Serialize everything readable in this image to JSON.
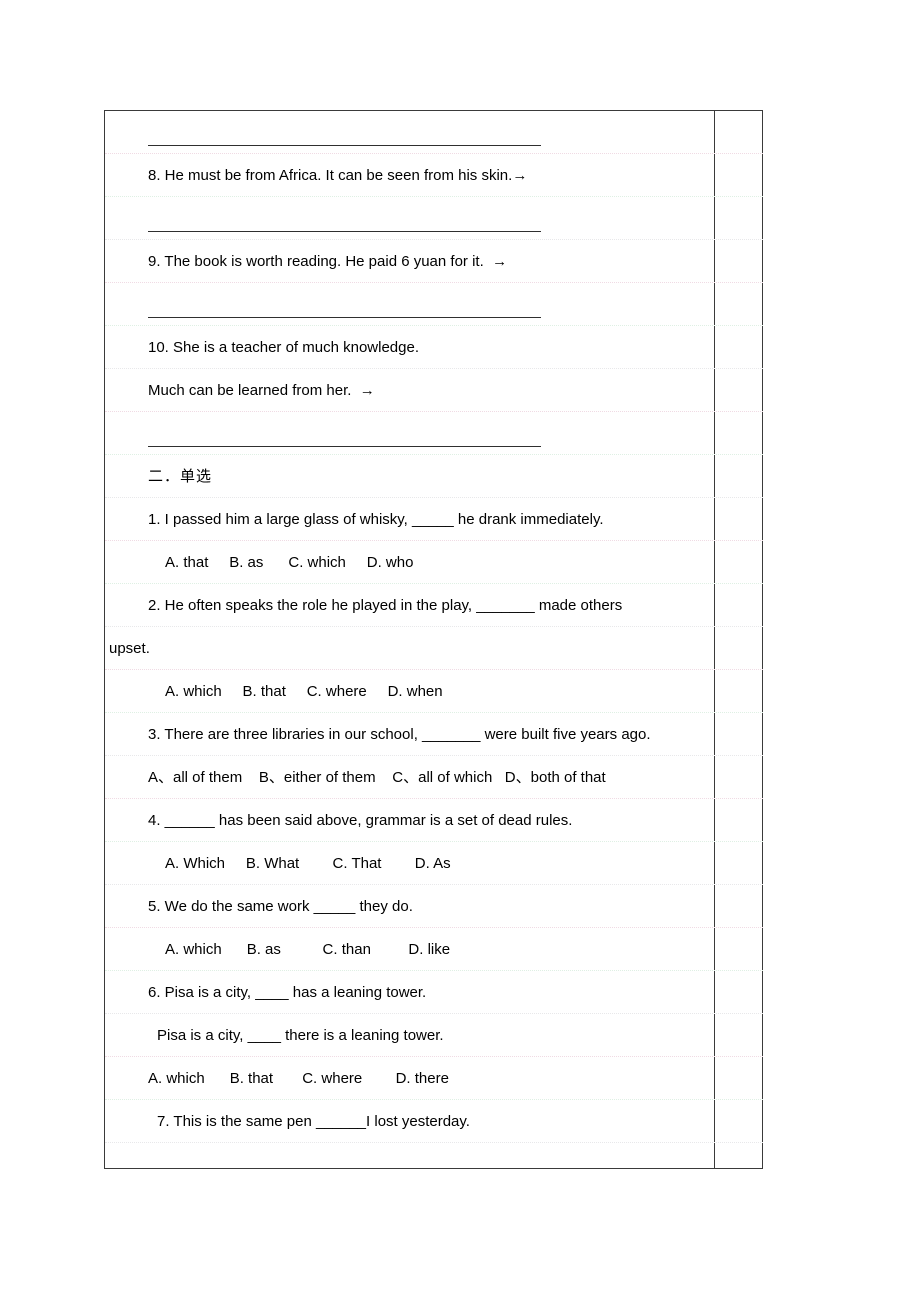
{
  "document": {
    "rows": [
      {
        "kind": "rule",
        "name": "answer-rule-7"
      },
      {
        "kind": "text",
        "name": "question-8",
        "text": "8. He must be from Africa. It can be seen from his skin.→"
      },
      {
        "kind": "rule",
        "name": "answer-rule-8"
      },
      {
        "kind": "text",
        "name": "question-9",
        "text": "9. The book is worth reading. He paid 6 yuan for it.  →"
      },
      {
        "kind": "rule",
        "name": "answer-rule-9"
      },
      {
        "kind": "text",
        "name": "question-10",
        "text": "10. She is a teacher of much knowledge."
      },
      {
        "kind": "text",
        "name": "question-10-line-2",
        "text": "Much can be learned from her.  →"
      },
      {
        "kind": "rule",
        "name": "answer-rule-10"
      },
      {
        "kind": "heading",
        "name": "section-two-heading",
        "text": "二．单选"
      },
      {
        "kind": "text",
        "name": "question-1",
        "text": "1. I passed him a large glass of whisky, _____ he drank immediately."
      },
      {
        "kind": "opts",
        "name": "question-1-options",
        "text": "A. that     B. as      C. which     D. who"
      },
      {
        "kind": "text",
        "name": "question-2",
        "text": "2. He often speaks the role he played in the play, _______ made others"
      },
      {
        "kind": "overflow",
        "name": "question-2-continued",
        "text": "upset."
      },
      {
        "kind": "opts",
        "name": "question-2-options",
        "text": "A. which     B. that     C. where     D. when"
      },
      {
        "kind": "text",
        "name": "question-3",
        "text": "3. There are three libraries in our school, _______ were built five years ago."
      },
      {
        "kind": "opts",
        "name": "question-3-options",
        "flush": true,
        "text": "A、all of them    B、either of them    C、all of which   D、both of that"
      },
      {
        "kind": "text",
        "name": "question-4",
        "text": "4. ______ has been said above, grammar is a set of dead rules."
      },
      {
        "kind": "opts",
        "name": "question-4-options",
        "text": "A. Which     B. What        C. That        D. As"
      },
      {
        "kind": "text",
        "name": "question-5",
        "text": "5. We do the same work _____ they do."
      },
      {
        "kind": "opts",
        "name": "question-5-options",
        "text": "A. which      B. as          C. than         D. like"
      },
      {
        "kind": "text",
        "name": "question-6",
        "text": "6. Pisa is a city, ____ has a leaning tower."
      },
      {
        "kind": "text",
        "name": "question-6-line-2",
        "indent": true,
        "text": "Pisa is a city, ____ there is a leaning tower."
      },
      {
        "kind": "opts",
        "name": "question-6-options",
        "flush": true,
        "text": "A. which      B. that       C. where        D. there"
      },
      {
        "kind": "text",
        "name": "question-7",
        "indent": true,
        "text": "7. This is the same pen ______I lost yesterday."
      }
    ]
  },
  "layout": {
    "side_column_label": ""
  },
  "colors": {
    "border": "#3a3a3a",
    "rule": "#2f2f2f",
    "gridline_pink": "#f0dbe4",
    "gridline_green": "#dff0e4",
    "gridline_gray": "#e8e8ea",
    "text": "#000000",
    "page_background": "#ffffff"
  }
}
